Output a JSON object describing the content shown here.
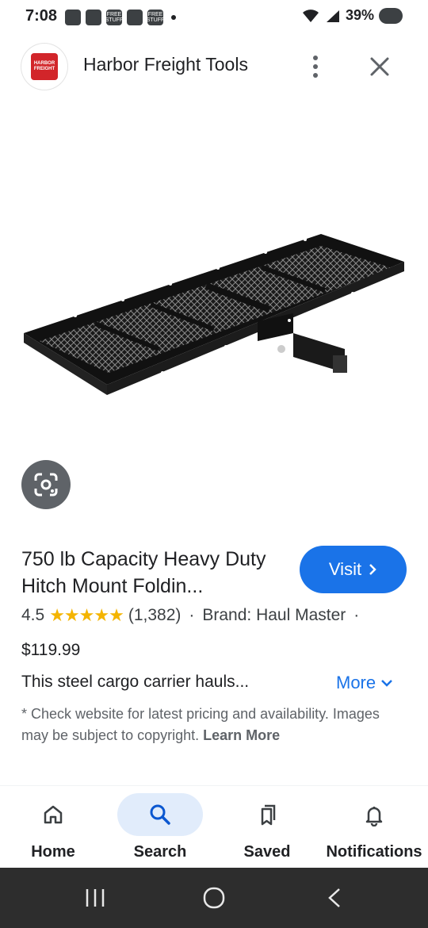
{
  "status_bar": {
    "time": "7:08",
    "notif_icons": [
      "",
      "",
      "",
      "FREE STUFF",
      "",
      "FREE STUFF"
    ],
    "battery": "39%"
  },
  "header": {
    "logo_text": "HARBOR FREIGHT",
    "title": "Harbor Freight Tools",
    "menu_icon": "more-vert-icon",
    "close_icon": "close-icon"
  },
  "product": {
    "title": "750 lb Capacity Heavy Duty Hitch Mount Foldin...",
    "visit_label": "Visit",
    "rating": "4.5",
    "stars": "★★★★★",
    "review_count": "(1,382)",
    "brand": "Brand: Haul Master",
    "price": "$119.99",
    "description": "This steel cargo carrier hauls...",
    "more_label": "More",
    "disclaimer": "* Check website for latest pricing and availability. Images may be subject to copyright.",
    "learn_more": "Learn More"
  },
  "bottom_nav": {
    "items": [
      {
        "label": "Home",
        "icon": "home-icon"
      },
      {
        "label": "Search",
        "icon": "search-icon"
      },
      {
        "label": "Saved",
        "icon": "saved-icon"
      },
      {
        "label": "Notifications",
        "icon": "bell-icon"
      }
    ],
    "active": "Search"
  },
  "colors": {
    "accent": "#1a73e8",
    "star": "#f4b400",
    "brand_red": "#d2252a"
  }
}
